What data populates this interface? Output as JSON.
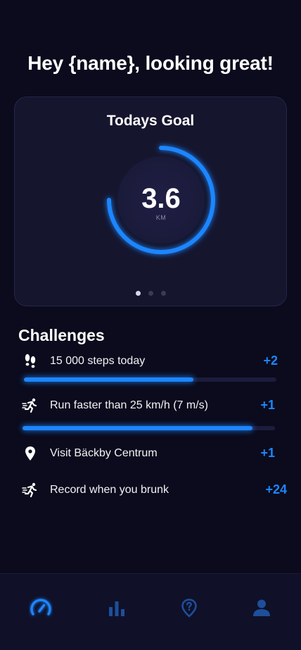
{
  "header": {
    "greeting": "Hey {name}, looking great!"
  },
  "goal_card": {
    "title": "Todays Goal",
    "value": "3.6",
    "unit": "KM",
    "progress": 0.75,
    "pages": 3,
    "active_page": 0
  },
  "challenges": {
    "title": "Challenges",
    "items": [
      {
        "label": "15 000 steps today",
        "reward": "+2",
        "icon": "footprints-icon",
        "progress": 0.67
      },
      {
        "label": "Run faster than 25 km/h (7 m/s)",
        "reward": "+1",
        "icon": "running-icon",
        "progress": 0.91
      },
      {
        "label": "Visit Bäckby Centrum",
        "reward": "+1",
        "icon": "location-pin-icon"
      },
      {
        "label": "Record when you brunk",
        "reward": "+24",
        "icon": "running-icon"
      }
    ]
  },
  "tabbar": {
    "items": [
      {
        "icon": "speedometer-icon",
        "active": true
      },
      {
        "icon": "bar-chart-icon",
        "active": false
      },
      {
        "icon": "question-pin-icon",
        "active": false
      },
      {
        "icon": "user-icon",
        "active": false
      }
    ]
  },
  "colors": {
    "background": "#0b0b1d",
    "card": "#15152e",
    "accent": "#1c86ff",
    "inactive_icon": "#1d4f9a"
  }
}
